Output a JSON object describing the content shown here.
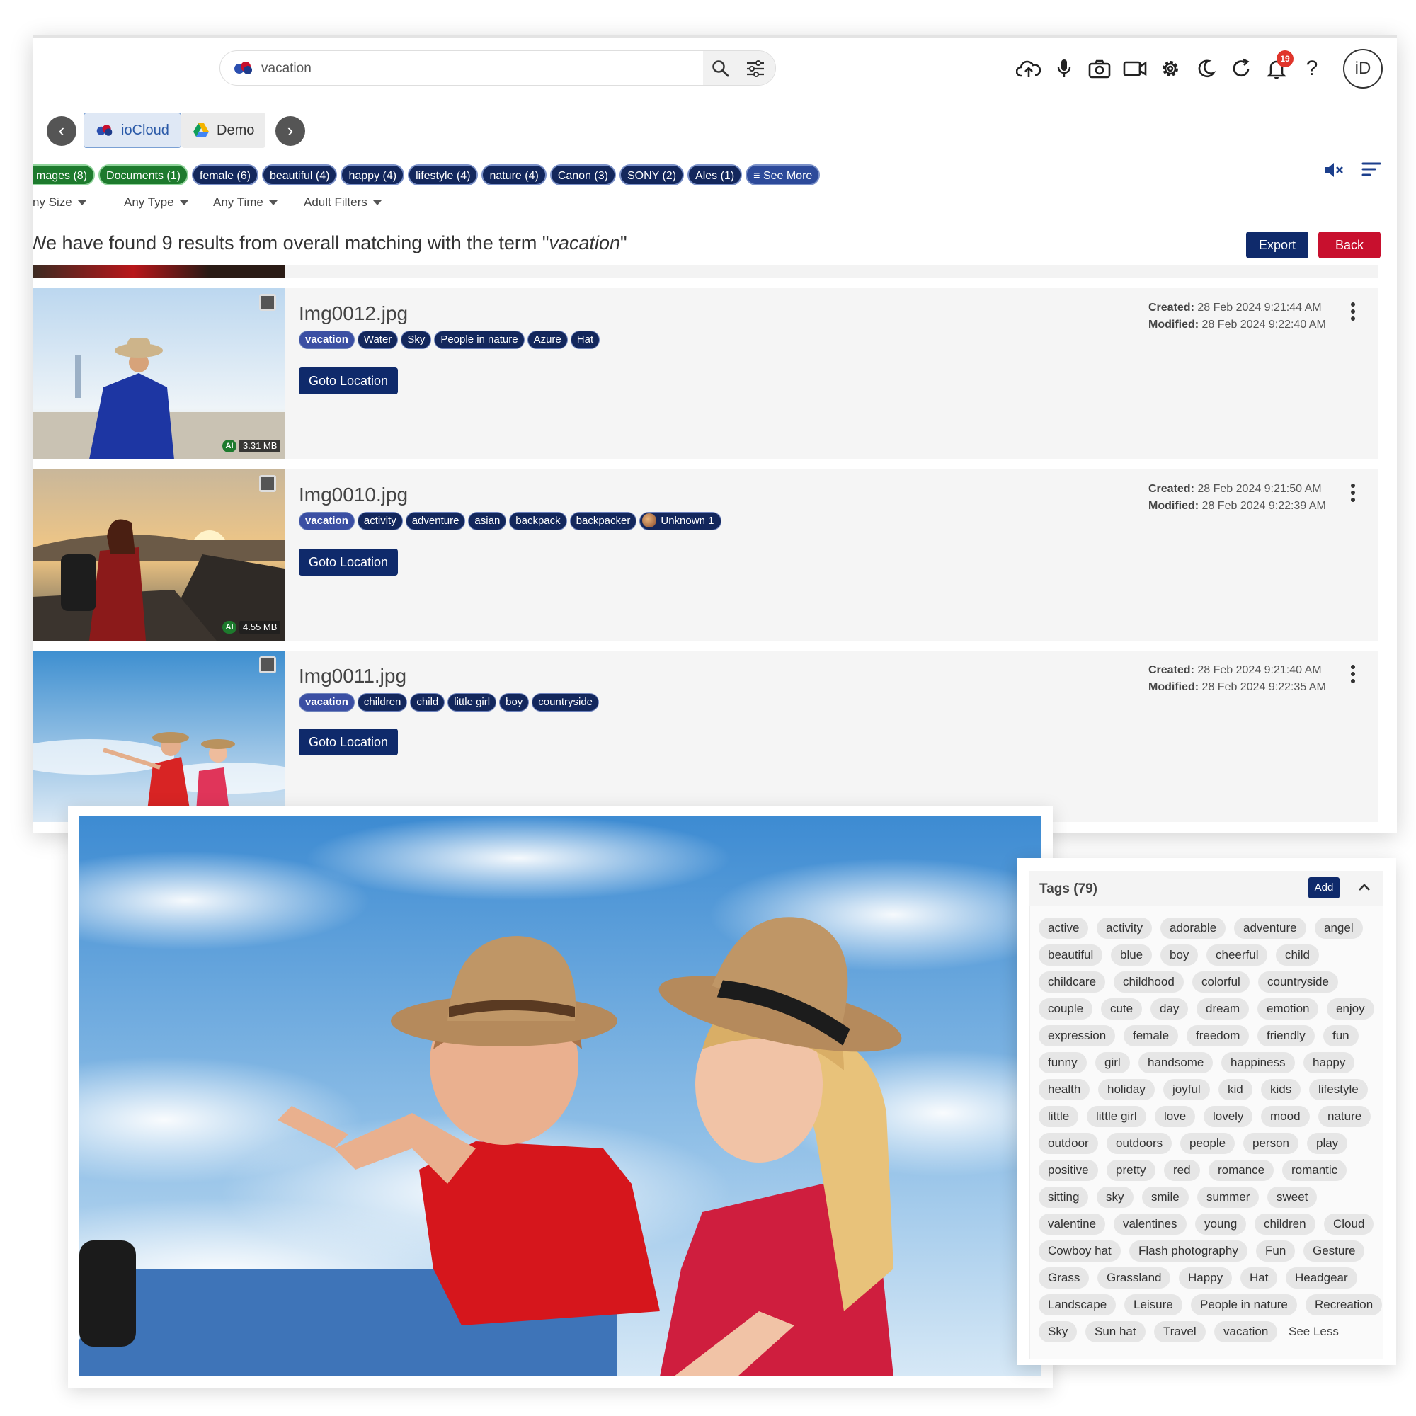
{
  "search": {
    "query": "vacation"
  },
  "header": {
    "notification_count": "19",
    "avatar_initials": "iD"
  },
  "sources": [
    {
      "label": "ioCloud",
      "active": true
    },
    {
      "label": "Demo",
      "active": false
    }
  ],
  "facets": [
    "mages (8)",
    "Documents (1)",
    "female (6)",
    "beautiful (4)",
    "happy (4)",
    "lifestyle (4)",
    "nature (4)",
    "Canon (3)",
    "SONY (2)",
    "Ales (1)"
  ],
  "see_more_label": "See More",
  "filters": [
    "ny Size",
    "Any Type",
    "Any Time",
    "Adult Filters"
  ],
  "result_summary": {
    "prefix": "We have found 9 results from overall matching with the term ",
    "term": "vacation"
  },
  "actions": {
    "export": "Export",
    "back": "Back"
  },
  "results": [
    {
      "filename": "Img0012.jpg",
      "size": "3.31 MB",
      "ai_badge": "AI",
      "tags": [
        "vacation",
        "Water",
        "Sky",
        "People in nature",
        "Azure",
        "Hat"
      ],
      "goto_label": "Goto Location",
      "created_label": "Created:",
      "created": "28 Feb 2024 9:21:44 AM",
      "modified_label": "Modified:",
      "modified": "28 Feb 2024 9:22:40 AM"
    },
    {
      "filename": "Img0010.jpg",
      "size": "4.55 MB",
      "ai_badge": "AI",
      "tags": [
        "vacation",
        "activity",
        "adventure",
        "asian",
        "backpack",
        "backpacker"
      ],
      "face_tag": "Unknown 1",
      "goto_label": "Goto Location",
      "created_label": "Created:",
      "created": "28 Feb 2024 9:21:50 AM",
      "modified_label": "Modified:",
      "modified": "28 Feb 2024 9:22:39 AM"
    },
    {
      "filename": "Img0011.jpg",
      "tags": [
        "vacation",
        "children",
        "child",
        "little girl",
        "boy",
        "countryside"
      ],
      "goto_label": "Goto Location",
      "created_label": "Created:",
      "created": "28 Feb 2024 9:21:40 AM",
      "modified_label": "Modified:",
      "modified": "28 Feb 2024 9:22:35 AM"
    }
  ],
  "tags_panel": {
    "title": "Tags (79)",
    "add_label": "Add",
    "see_less": "See Less",
    "rows": [
      [
        "active",
        "activity",
        "adorable",
        "adventure",
        "angel"
      ],
      [
        "beautiful",
        "blue",
        "boy",
        "cheerful",
        "child"
      ],
      [
        "childcare",
        "childhood",
        "colorful",
        "countryside"
      ],
      [
        "couple",
        "cute",
        "day",
        "dream",
        "emotion",
        "enjoy"
      ],
      [
        "expression",
        "female",
        "freedom",
        "friendly",
        "fun"
      ],
      [
        "funny",
        "girl",
        "handsome",
        "happiness",
        "happy"
      ],
      [
        "health",
        "holiday",
        "joyful",
        "kid",
        "kids",
        "lifestyle"
      ],
      [
        "little",
        "little girl",
        "love",
        "lovely",
        "mood",
        "nature"
      ],
      [
        "outdoor",
        "outdoors",
        "people",
        "person",
        "play"
      ],
      [
        "positive",
        "pretty",
        "red",
        "romance",
        "romantic"
      ],
      [
        "sitting",
        "sky",
        "smile",
        "summer",
        "sweet"
      ],
      [
        "valentine",
        "valentines",
        "young",
        "children",
        "Cloud"
      ],
      [
        "Cowboy hat",
        "Flash photography",
        "Fun",
        "Gesture"
      ],
      [
        "Grass",
        "Grassland",
        "Happy",
        "Hat",
        "Headgear"
      ],
      [
        "Landscape",
        "Leisure",
        "People in nature",
        "Recreation"
      ],
      [
        "Sky",
        "Sun hat",
        "Travel",
        "vacation"
      ]
    ]
  },
  "colors": {
    "navy": "#0f2a6b",
    "red": "#c8102e",
    "green": "#1d7a2d",
    "badge": "#e0352b"
  }
}
